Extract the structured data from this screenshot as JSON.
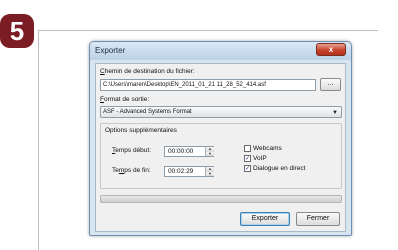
{
  "step": {
    "number": "5"
  },
  "dialog": {
    "title": "Exporter",
    "close_label": "x",
    "destination": {
      "label_first": "C",
      "label_rest": "hemin de destination du fichier:",
      "value": "C:\\Users\\maren\\Desktop\\EN_2011_01_21 11_28_52_414.asf",
      "browse_label": "..."
    },
    "format": {
      "label_first": "F",
      "label_rest": "ormat de sortie:",
      "selected": "ASF - Advanced Systems Format",
      "arrow": "▼"
    },
    "options": {
      "title": "Options supplémentaires",
      "start": {
        "label_first": "T",
        "label_rest": "emps début:",
        "value": "00:00:00"
      },
      "end": {
        "label_first": "T",
        "label_mid": "e",
        "label_u": "m",
        "label_rest": "ps de fin:",
        "value": "00:02:29"
      },
      "spin_up": "▲",
      "spin_down": "▼",
      "checkboxes": [
        {
          "label": "Webcams",
          "checked": false
        },
        {
          "label": "VoIP",
          "checked": true
        },
        {
          "label": "Dialogue en direct",
          "checked": true
        }
      ]
    },
    "progress": 0,
    "buttons": {
      "export_label": "Exporter",
      "close_label": "Fermer"
    }
  }
}
